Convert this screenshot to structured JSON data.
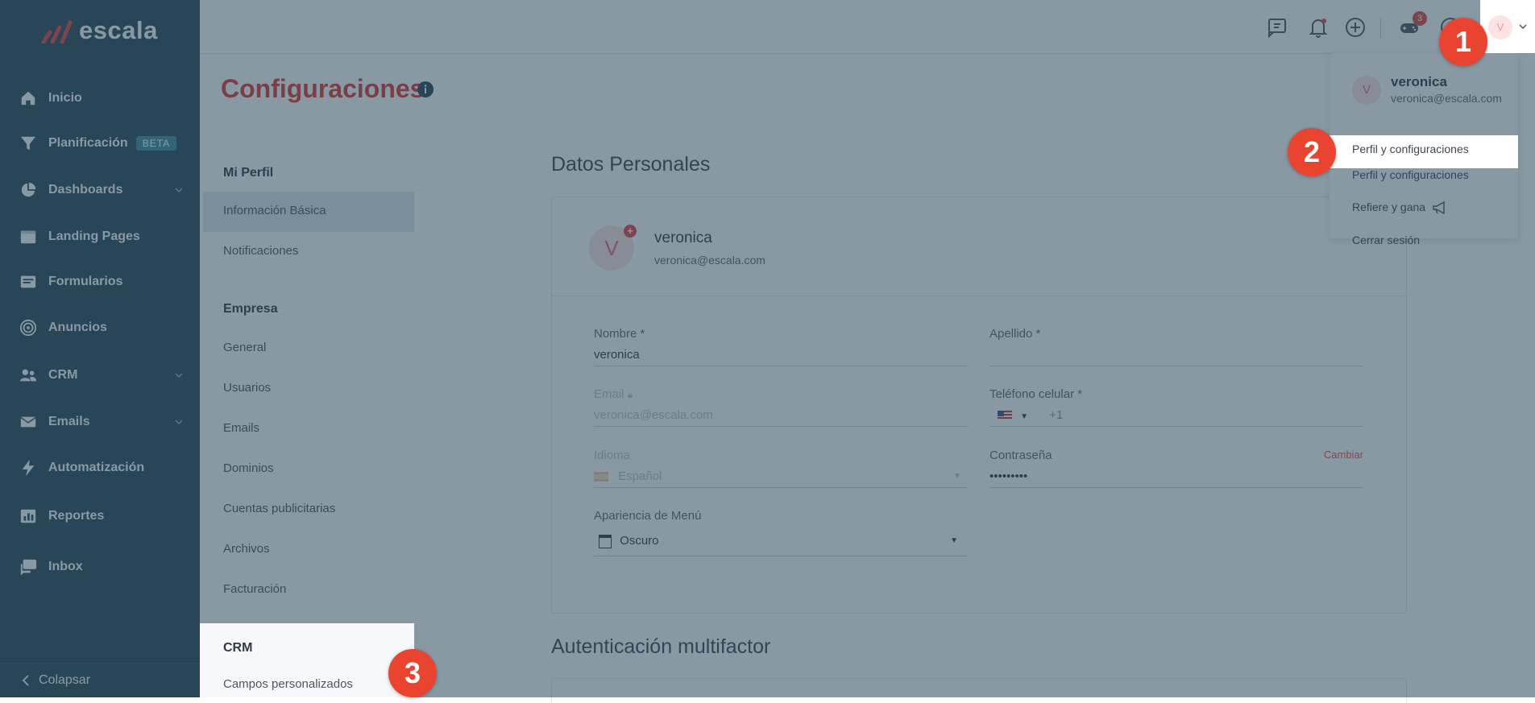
{
  "brand": {
    "name": "escala",
    "trademark": "™"
  },
  "sidebar": {
    "items": [
      {
        "label": "Inicio",
        "icon": "home-icon"
      },
      {
        "label": "Planificación",
        "icon": "filter-icon",
        "badge": "BETA"
      },
      {
        "label": "Dashboards",
        "icon": "pie-chart-icon",
        "has_chevron": true
      },
      {
        "label": "Landing Pages",
        "icon": "browser-window-icon"
      },
      {
        "label": "Formularios",
        "icon": "form-icon"
      },
      {
        "label": "Anuncios",
        "icon": "target-icon"
      },
      {
        "label": "CRM",
        "icon": "people-icon",
        "has_chevron": true
      },
      {
        "label": "Emails",
        "icon": "envelope-icon",
        "has_chevron": true
      },
      {
        "label": "Automatización",
        "icon": "lightning-icon"
      },
      {
        "label": "Reportes",
        "icon": "report-chart-icon"
      },
      {
        "label": "Inbox",
        "icon": "chat-bubbles-icon"
      }
    ],
    "collapse_label": "Colapsar"
  },
  "topbar": {
    "notification_count": "3",
    "avatar_initial": "V"
  },
  "page": {
    "title": "Configuraciones"
  },
  "settings_nav": {
    "sections": [
      {
        "heading": "Mi Perfil",
        "items": [
          "Información Básica",
          "Notificaciones"
        ]
      },
      {
        "heading": "Empresa",
        "items": [
          "General",
          "Usuarios",
          "Emails",
          "Dominios",
          "Cuentas publicitarias",
          "Archivos",
          "Facturación"
        ]
      },
      {
        "heading": "CRM",
        "items": [
          "Campos personalizados"
        ]
      }
    ],
    "active_item": "Información Básica"
  },
  "content": {
    "personal_title": "Datos Personales",
    "mfa_title": "Autenticación multifactor",
    "user": {
      "initial": "V",
      "name": "veronica",
      "email": "veronica@escala.com"
    },
    "fields": {
      "nombre": {
        "label": "Nombre *",
        "value": "veronica"
      },
      "apellido": {
        "label": "Apellido *",
        "value": ""
      },
      "email": {
        "label": "Email",
        "value": "veronica@escala.com",
        "disabled": true
      },
      "telefono": {
        "label": "Teléfono celular *",
        "prefix": "+1",
        "value": ""
      },
      "idioma": {
        "label": "Idioma",
        "value": "Español",
        "disabled": true
      },
      "contrasena": {
        "label": "Contraseña",
        "value": "•••••••••",
        "action": "Cambiar"
      },
      "apariencia": {
        "label": "Apariencia de Menú",
        "value": "Oscuro"
      }
    }
  },
  "dropdown": {
    "name": "veronica",
    "email": "veronica@escala.com",
    "items": [
      "Perfil y configuraciones",
      "Refiere y gana",
      "Cerrar sesión"
    ]
  },
  "markers": [
    "1",
    "2",
    "3"
  ],
  "colors": {
    "sidebar": "#2b4658",
    "accent_red": "#d93b30",
    "marker": "#e8442f",
    "overlay": "rgba(40,70,90,0.55)"
  }
}
